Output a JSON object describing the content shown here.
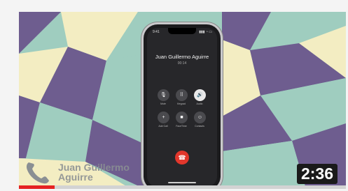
{
  "video": {
    "duration": "2:36",
    "progress_fraction": 0.11
  },
  "phone": {
    "caller_name": "Juan Guillermo Aguirre",
    "call_status": "00:14",
    "status_time": "9:41",
    "status_icons": "▮▮▮ ◔ ▭",
    "controls": [
      {
        "icon": "mute-icon",
        "glyph": "🎙",
        "label": "Mute"
      },
      {
        "icon": "keypad-icon",
        "glyph": "⠿",
        "label": "Keypad"
      },
      {
        "icon": "speaker-icon",
        "glyph": "🔊",
        "label": "Audio"
      },
      {
        "icon": "add-call-icon",
        "glyph": "+",
        "label": "Add Call"
      },
      {
        "icon": "facetime-icon",
        "glyph": "■",
        "label": "FaceTime"
      },
      {
        "icon": "contacts-icon",
        "glyph": "☺",
        "label": "Contacts"
      }
    ]
  },
  "watermark": {
    "line1": "Juan Guillermo",
    "line2": "Aguirre"
  },
  "colors": {
    "teal": "#9fcdbf",
    "purple": "#6e5d8f",
    "cream": "#f3edc2",
    "end_call": "#e2372c",
    "progress": "#e52222"
  }
}
